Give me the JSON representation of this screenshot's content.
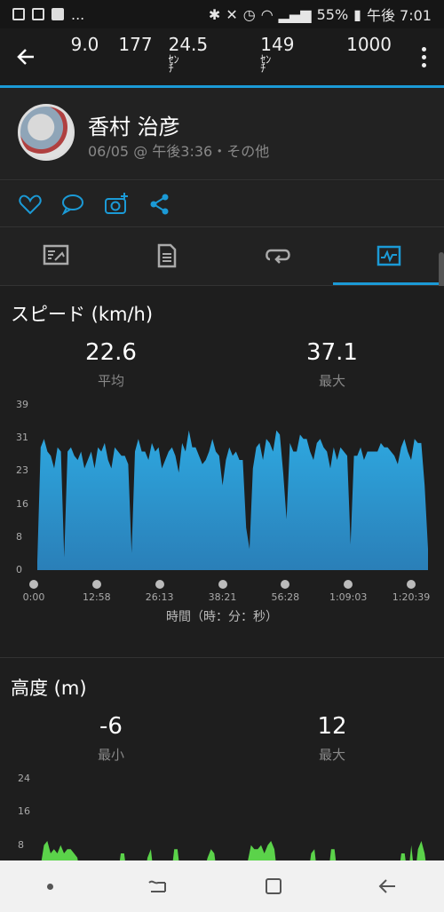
{
  "status_bar": {
    "battery": "55%",
    "time": "午後 7:01",
    "more": "..."
  },
  "app_bar": {
    "stats": [
      "9.0",
      "177",
      "24.5",
      "149",
      "1000"
    ],
    "stat_unit_sen": "ｾﾝ",
    "stat_unit_chi": "ﾁ"
  },
  "activity": {
    "name": "香村 治彦",
    "subtitle": "06/05 @ 午後3:36・その他"
  },
  "speed_chart": {
    "title": "スピード (km/h)",
    "avg_value": "22.6",
    "avg_label": "平均",
    "max_value": "37.1",
    "max_label": "最大",
    "xaxis_label": "時間（時：分：秒）"
  },
  "elevation_chart": {
    "title": "高度 (m)",
    "min_value": "-6",
    "min_label": "最小",
    "max_value": "12",
    "max_label": "最大"
  },
  "colors": {
    "accent": "#1b9ad6",
    "speed_fill": "#2ea0d8",
    "elev_fill": "#5bd34a"
  },
  "chart_data": [
    {
      "type": "area",
      "title": "スピード (km/h)",
      "xlabel": "時間（時：分：秒）",
      "ylabel": "",
      "ylim": [
        0,
        39
      ],
      "yticks": [
        "39",
        "31",
        "23",
        "16",
        "8",
        "0"
      ],
      "xticks": [
        "0:00",
        "12:58",
        "26:13",
        "38:21",
        "56:28",
        "1:09:03",
        "1:20:39"
      ],
      "series": [
        {
          "values": [
            2,
            29,
            31,
            28,
            27,
            24,
            29,
            28,
            3,
            28,
            29,
            27,
            26,
            28,
            24,
            26,
            28,
            24,
            29,
            28,
            30,
            26,
            24,
            29,
            28,
            27,
            27,
            25,
            4,
            28,
            31,
            28,
            28,
            26,
            30,
            28,
            29,
            24,
            26,
            28,
            29,
            27,
            23,
            30,
            28,
            33,
            29,
            29,
            27,
            25,
            26,
            28,
            31,
            28,
            27,
            20,
            26,
            29,
            27,
            28,
            26,
            26,
            10,
            5,
            24,
            29,
            30,
            26,
            31,
            30,
            28,
            33,
            32,
            23,
            12,
            30,
            28,
            28,
            32,
            31,
            31,
            28,
            26,
            30,
            31,
            29,
            28,
            24,
            29,
            26,
            29,
            28,
            27,
            6,
            27,
            27,
            29,
            26,
            28,
            28,
            28,
            28,
            30,
            29,
            29,
            28,
            27,
            25,
            29,
            31,
            28,
            26,
            31,
            30,
            30,
            20,
            5
          ]
        }
      ]
    },
    {
      "type": "area",
      "title": "高度 (m)",
      "xlabel": "",
      "ylabel": "",
      "ylim": [
        0,
        24
      ],
      "yticks": [
        "24",
        "16",
        "8"
      ],
      "series": [
        {
          "values": [
            0,
            3,
            8,
            9,
            6,
            7,
            6,
            8,
            6,
            7,
            7,
            6,
            5,
            0,
            0,
            0,
            0,
            0,
            0,
            0,
            0,
            0,
            0,
            0,
            0,
            6,
            6,
            0,
            0,
            0,
            0,
            0,
            0,
            5,
            7,
            0,
            0,
            0,
            0,
            0,
            0,
            7,
            7,
            0,
            0,
            0,
            0,
            0,
            0,
            0,
            2,
            5,
            7,
            6,
            0,
            0,
            0,
            0,
            0,
            0,
            0,
            0,
            0,
            4,
            8,
            7,
            7,
            8,
            6,
            8,
            9,
            7,
            0,
            0,
            0,
            0,
            0,
            0,
            0,
            0,
            0,
            0,
            6,
            7,
            0,
            0,
            0,
            0,
            7,
            7,
            0,
            0,
            0,
            0,
            0,
            0,
            0,
            0,
            0,
            0,
            0,
            0,
            0,
            0,
            0,
            0,
            0,
            0,
            0,
            6,
            6,
            0,
            8,
            0,
            7,
            9,
            6,
            0
          ]
        }
      ]
    }
  ]
}
